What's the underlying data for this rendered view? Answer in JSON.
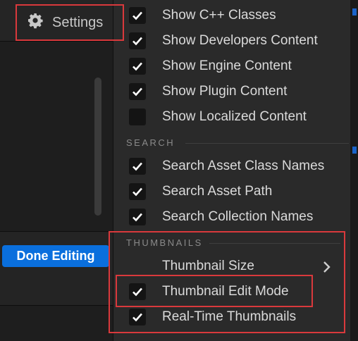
{
  "toolbar": {
    "settings_label": "Settings"
  },
  "left": {
    "done_label": "Done Editing"
  },
  "menu": {
    "items_top": [
      {
        "label": "Show C++ Classes",
        "checked": true
      },
      {
        "label": "Show Developers Content",
        "checked": true
      },
      {
        "label": "Show Engine Content",
        "checked": true
      },
      {
        "label": "Show Plugin Content",
        "checked": true
      },
      {
        "label": "Show Localized Content",
        "checked": false
      }
    ],
    "search_header": "SEARCH",
    "search_items": [
      {
        "label": "Search Asset Class Names",
        "checked": true
      },
      {
        "label": "Search Asset Path",
        "checked": true
      },
      {
        "label": "Search Collection Names",
        "checked": true
      }
    ],
    "thumbnails_header": "THUMBNAILS",
    "thumbnail_size_label": "Thumbnail Size",
    "thumbnail_edit_mode": {
      "label": "Thumbnail Edit Mode",
      "checked": true
    },
    "realtime_thumbnails": {
      "label": "Real-Time Thumbnails",
      "checked": true
    }
  },
  "colors": {
    "accent": "#0a6fdd",
    "highlight": "#d9393c"
  }
}
